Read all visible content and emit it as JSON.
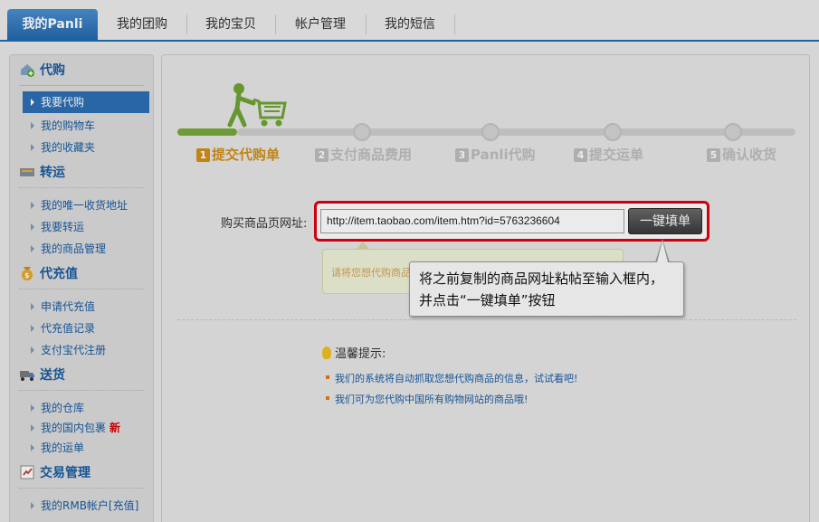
{
  "topnav": {
    "tabs": [
      {
        "label": "我的Panli",
        "active": true
      },
      {
        "label": "我的团购"
      },
      {
        "label": "我的宝贝"
      },
      {
        "label": "帐户管理"
      },
      {
        "label": "我的短信"
      }
    ]
  },
  "sidebar": {
    "sections": [
      {
        "title": "代购",
        "icon": "purchase-icon",
        "items": [
          {
            "label": "我要代购",
            "active": true
          },
          {
            "label": "我的购物车"
          },
          {
            "label": "我的收藏夹"
          }
        ]
      },
      {
        "title": "转运",
        "icon": "transfer-icon",
        "items": [
          {
            "label": "我的唯一收货地址"
          },
          {
            "label": "我要转运"
          },
          {
            "label": "我的商品管理"
          }
        ]
      },
      {
        "title": "代充值",
        "icon": "recharge-icon",
        "items": [
          {
            "label": "申请代充值"
          },
          {
            "label": "代充值记录"
          },
          {
            "label": "支付宝代注册"
          }
        ]
      },
      {
        "title": "送货",
        "icon": "truck-icon",
        "items": [
          {
            "label": "我的仓库"
          },
          {
            "label": "我的国内包裹",
            "badge": "新"
          },
          {
            "label": "我的运单"
          }
        ]
      },
      {
        "title": "交易管理",
        "icon": "trade-icon",
        "items": [
          {
            "label": "我的RMB帐户[充值]"
          }
        ]
      }
    ]
  },
  "steps": [
    {
      "num": "1",
      "label": "提交代购单",
      "current": true
    },
    {
      "num": "2",
      "label": "支付商品费用"
    },
    {
      "num": "3",
      "label": "Panli代购"
    },
    {
      "num": "4",
      "label": "提交运单"
    },
    {
      "num": "5",
      "label": "确认收货"
    }
  ],
  "form": {
    "url_label": "购买商品页网址:",
    "url_value": "http://item.taobao.com/item.htm?id=5763236604",
    "fill_button": "一键填单",
    "hint_text": "请将您想代购商品"
  },
  "callout": {
    "line1": "将之前复制的商品网址粘帖至输入框内，",
    "line2": "并点击“一键填单”按钮"
  },
  "tips": {
    "title": "温馨提示:",
    "items": [
      "我们的系统将自动抓取您想代购商品的信息，试试看吧!",
      "我们可为您代购中国所有购物网站的商品哦!"
    ]
  },
  "colors": {
    "brand_blue": "#1a5ca3",
    "active_tab": "#2468ab",
    "step_current": "#d1901a",
    "highlight_red": "#e00010",
    "progress_green": "#78a93a"
  }
}
